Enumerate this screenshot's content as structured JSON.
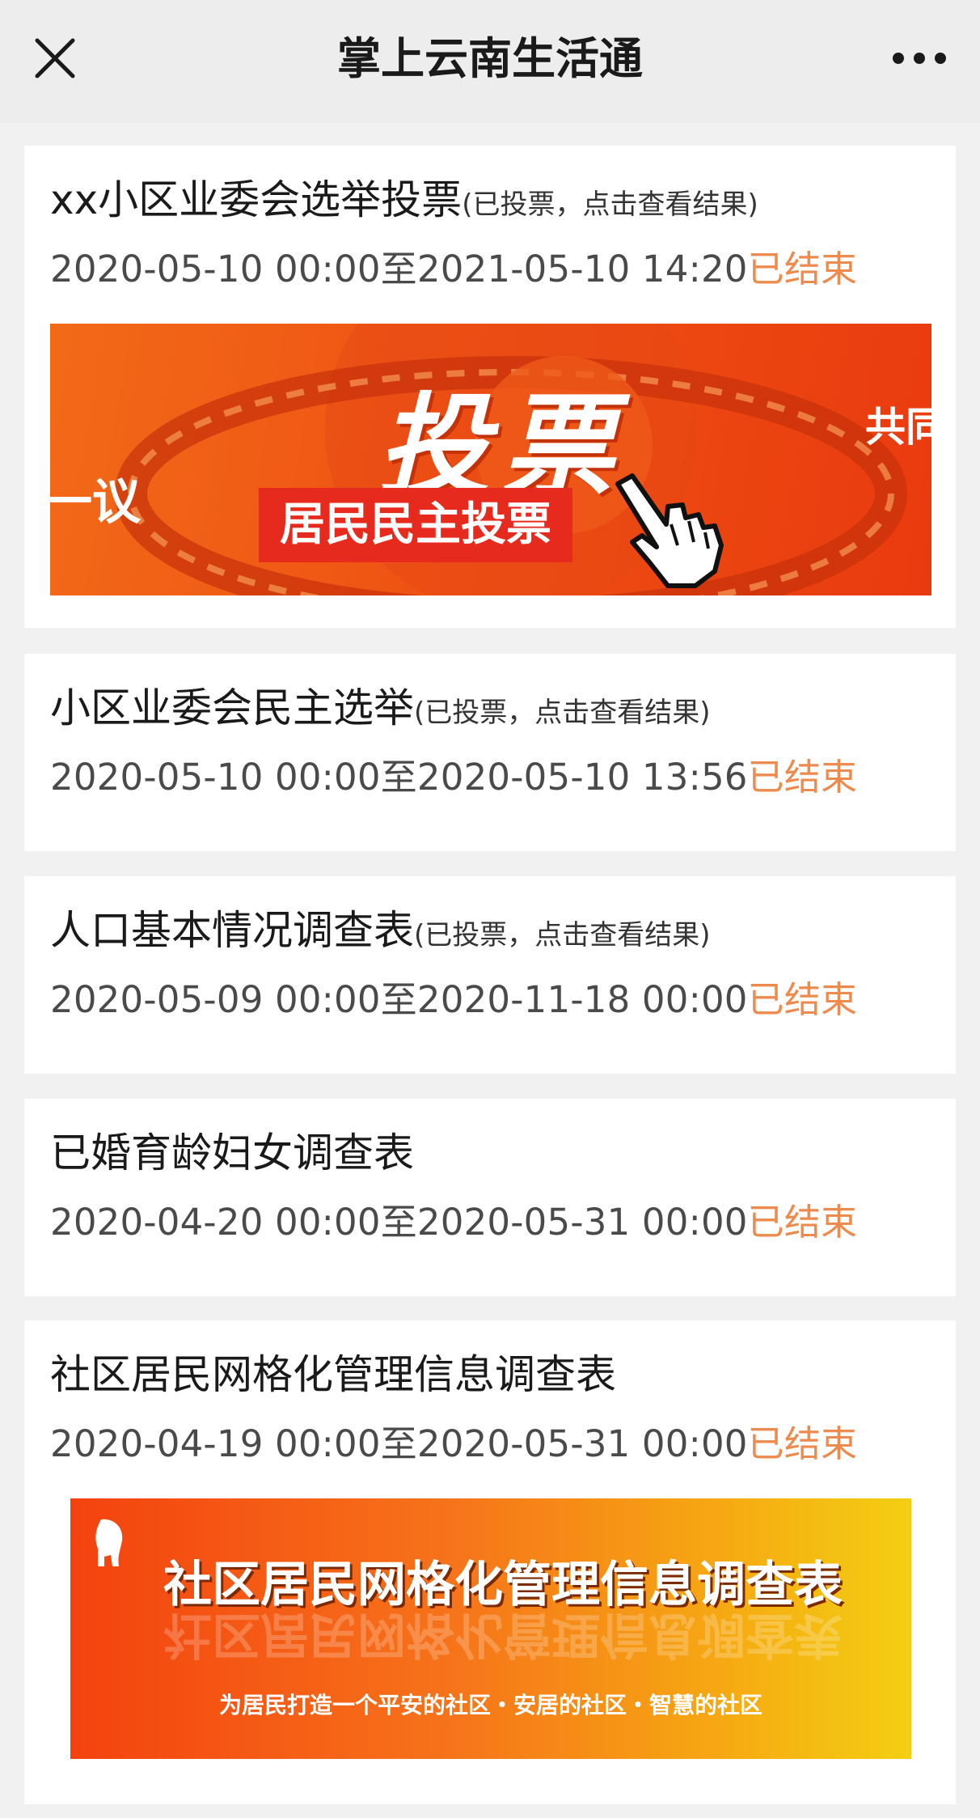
{
  "header": {
    "title": "掌上云南生活通",
    "close_icon": "close-icon",
    "more_icon": "more-dots-icon"
  },
  "colors": {
    "status_ended": "#ed8a4d",
    "background": "#f1f1f1",
    "card": "#ffffff"
  },
  "cards": [
    {
      "title": "xx小区业委会选举投票",
      "note": "(已投票，点击查看结果)",
      "dates": "2020-05-10 00:00至2021-05-10 14:20",
      "status": "已结束",
      "banner": {
        "big": "投票",
        "pill": "居民民主投票",
        "left_fragment": "一议",
        "right_fragment": "共同",
        "icon": "pointing-hand-icon"
      }
    },
    {
      "title": "小区业委会民主选举",
      "note": "(已投票，点击查看结果)",
      "dates": "2020-05-10 00:00至2020-05-10 13:56",
      "status": "已结束"
    },
    {
      "title": "人口基本情况调查表",
      "note": "(已投票，点击查看结果)",
      "dates": "2020-05-09 00:00至2020-11-18 00:00",
      "status": "已结束"
    },
    {
      "title": "已婚育龄妇女调查表",
      "note": "",
      "dates": "2020-04-20 00:00至2020-05-31 00:00",
      "status": "已结束"
    },
    {
      "title": "社区居民网格化管理信息调查表",
      "note": "",
      "dates": "2020-04-19 00:00至2020-05-31 00:00",
      "status": "已结束",
      "banner": {
        "title": "社区居民网格化管理信息调查表",
        "subtitle": "为居民打造一个平安的社区・安居的社区・智慧的社区",
        "icon": "elephant-logo-icon"
      }
    }
  ]
}
